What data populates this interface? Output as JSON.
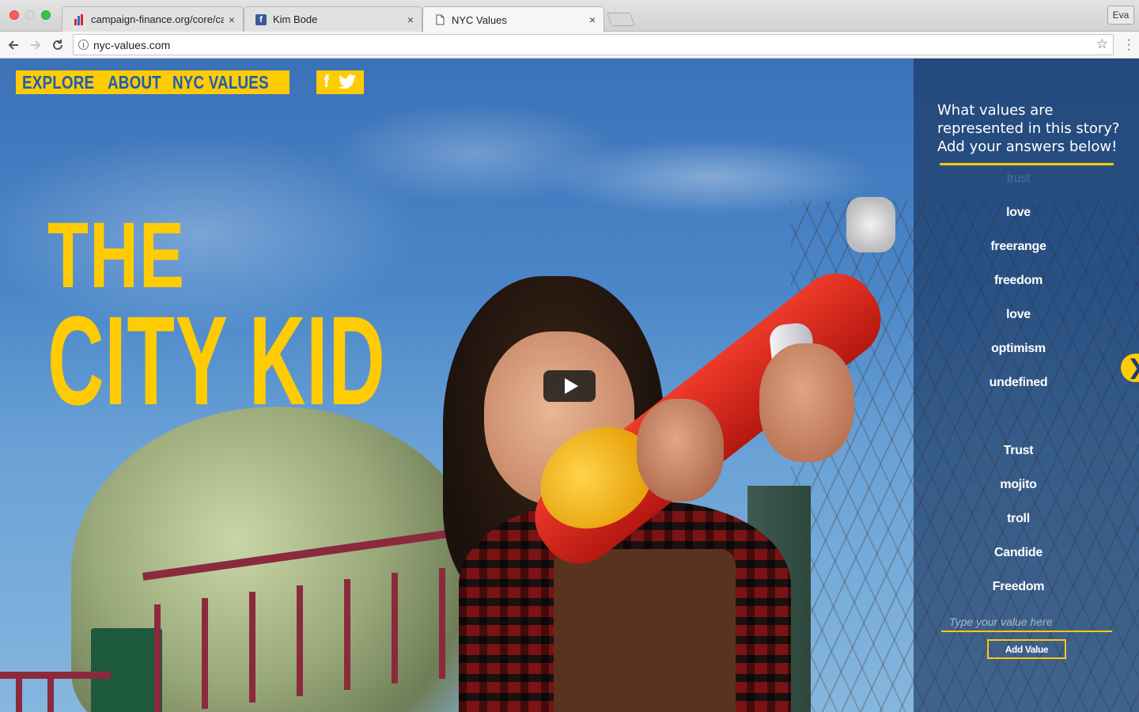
{
  "browser": {
    "tabs": [
      {
        "title": "campaign-finance.org/core/ca",
        "favicon": "bar-chart-favicon",
        "active": false
      },
      {
        "title": "Kim Bode",
        "favicon": "facebook-favicon",
        "active": false
      },
      {
        "title": "NYC Values",
        "favicon": "page-favicon",
        "active": true
      }
    ],
    "close_glyph": "×",
    "profile_name": "Eva",
    "url": "nyc-values.com"
  },
  "nav": {
    "links": [
      "EXPLORE",
      "ABOUT",
      "NYC VALUES"
    ],
    "facebook_glyph": "f"
  },
  "hero": {
    "title_line1": "THE",
    "title_line2": "CITY KID"
  },
  "sidebar": {
    "question": "What values are represented in this story? Add your answers below!",
    "faded_value": "trust",
    "values": [
      "love",
      "freerange",
      "freedom",
      "love",
      "optimism",
      "undefined",
      "",
      "Trust",
      "mojito",
      "troll",
      "Candide",
      "Freedom"
    ],
    "input_placeholder": "Type your value here",
    "add_button_label": "Add Value"
  },
  "colors": {
    "accent_yellow": "#fecb05",
    "nav_text_blue": "#1b5fb3",
    "sidebar_bg": "rgba(22,48,88,0.62)"
  },
  "icons": {
    "next": "chevron-right-icon",
    "play": "play-icon"
  }
}
